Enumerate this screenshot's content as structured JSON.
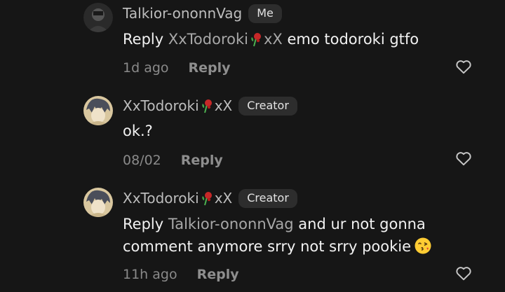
{
  "comments": [
    {
      "username": "Talkior-ononnVag",
      "badge": "Me",
      "reply_prefix": "Reply",
      "mention_name_start": "XxTodoroki",
      "mention_name_end": "xX",
      "text": "emo todoroki gtfo",
      "time": "1d ago",
      "reply_label": "Reply",
      "avatar_icon": "avatar-dark-photo",
      "like_icon": "heart-outline-icon"
    },
    {
      "username_start": "XxTodoroki",
      "username_end": "xX",
      "badge": "Creator",
      "text": "ok.?",
      "time": "08/02",
      "reply_label": "Reply",
      "avatar_icon": "avatar-anime-photo",
      "like_icon": "heart-outline-icon"
    },
    {
      "username_start": "XxTodoroki",
      "username_end": "xX",
      "badge": "Creator",
      "reply_prefix": "Reply",
      "mention": "Talkior-ononnVag",
      "text_line1": "and ur not gonna",
      "text_line2": "comment anymore srry not srry pookie",
      "emoji": "face-blowing-kiss-emoji",
      "time": "11h ago",
      "reply_label": "Reply",
      "avatar_icon": "avatar-anime-photo",
      "like_icon": "heart-outline-icon"
    }
  ],
  "colors": {
    "background": "#161616",
    "username": "#bdbdbd",
    "body_text": "#f2f2f2",
    "mention": "#a8a8a8",
    "badge_bg": "#2d2d2d",
    "meta": "#8a8a8a",
    "rose": "#c62828"
  }
}
